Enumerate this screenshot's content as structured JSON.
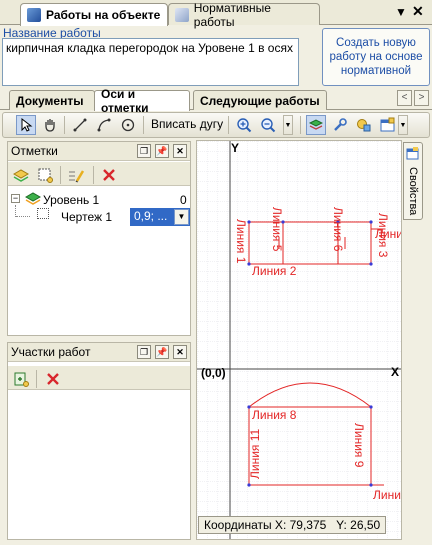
{
  "top_tabs": [
    {
      "label": "Работы на объекте",
      "active": true
    },
    {
      "label": "Нормативные работы",
      "active": false
    }
  ],
  "work": {
    "label": "Название работы",
    "value": "кирпичная кладка перегородок на Уровене 1 в осях"
  },
  "create_button": "Создать новую работу на основе нормативной",
  "tabs": [
    "Документы",
    "Оси и отметки",
    "Следующие работы"
  ],
  "toolbar": {
    "fit_arc": "Вписать дугу"
  },
  "marks_panel": {
    "title": "Отметки",
    "tree": {
      "level": {
        "label": "Уровень 1",
        "value": "0"
      },
      "drawing": {
        "label": "Чертеж 1",
        "value": "0,9; ..."
      }
    }
  },
  "areas_panel": {
    "title": "Участки работ"
  },
  "drawing": {
    "axis_y": "Y",
    "axis_x": "X",
    "origin": "(0,0)",
    "lines": {
      "l1": "Линия 1",
      "l2": "Линия 2",
      "l3": "Линия 3",
      "l3_side": "Лини",
      "l5": "Линия 5",
      "l6": "Линия 6",
      "l8": "Линия 8",
      "l9": "Линия 9",
      "l11": "Линия 11",
      "l_bottom": "Лини"
    }
  },
  "side_tab": "Свойства",
  "coords": {
    "x_label": "Координаты X:",
    "x": "79,375",
    "y_label": "Y:",
    "y": "26,50"
  },
  "colors": {
    "accent": "#1d4ea6",
    "drawing_red": "#e32626",
    "vertex_blue": "#3a3ad6"
  }
}
